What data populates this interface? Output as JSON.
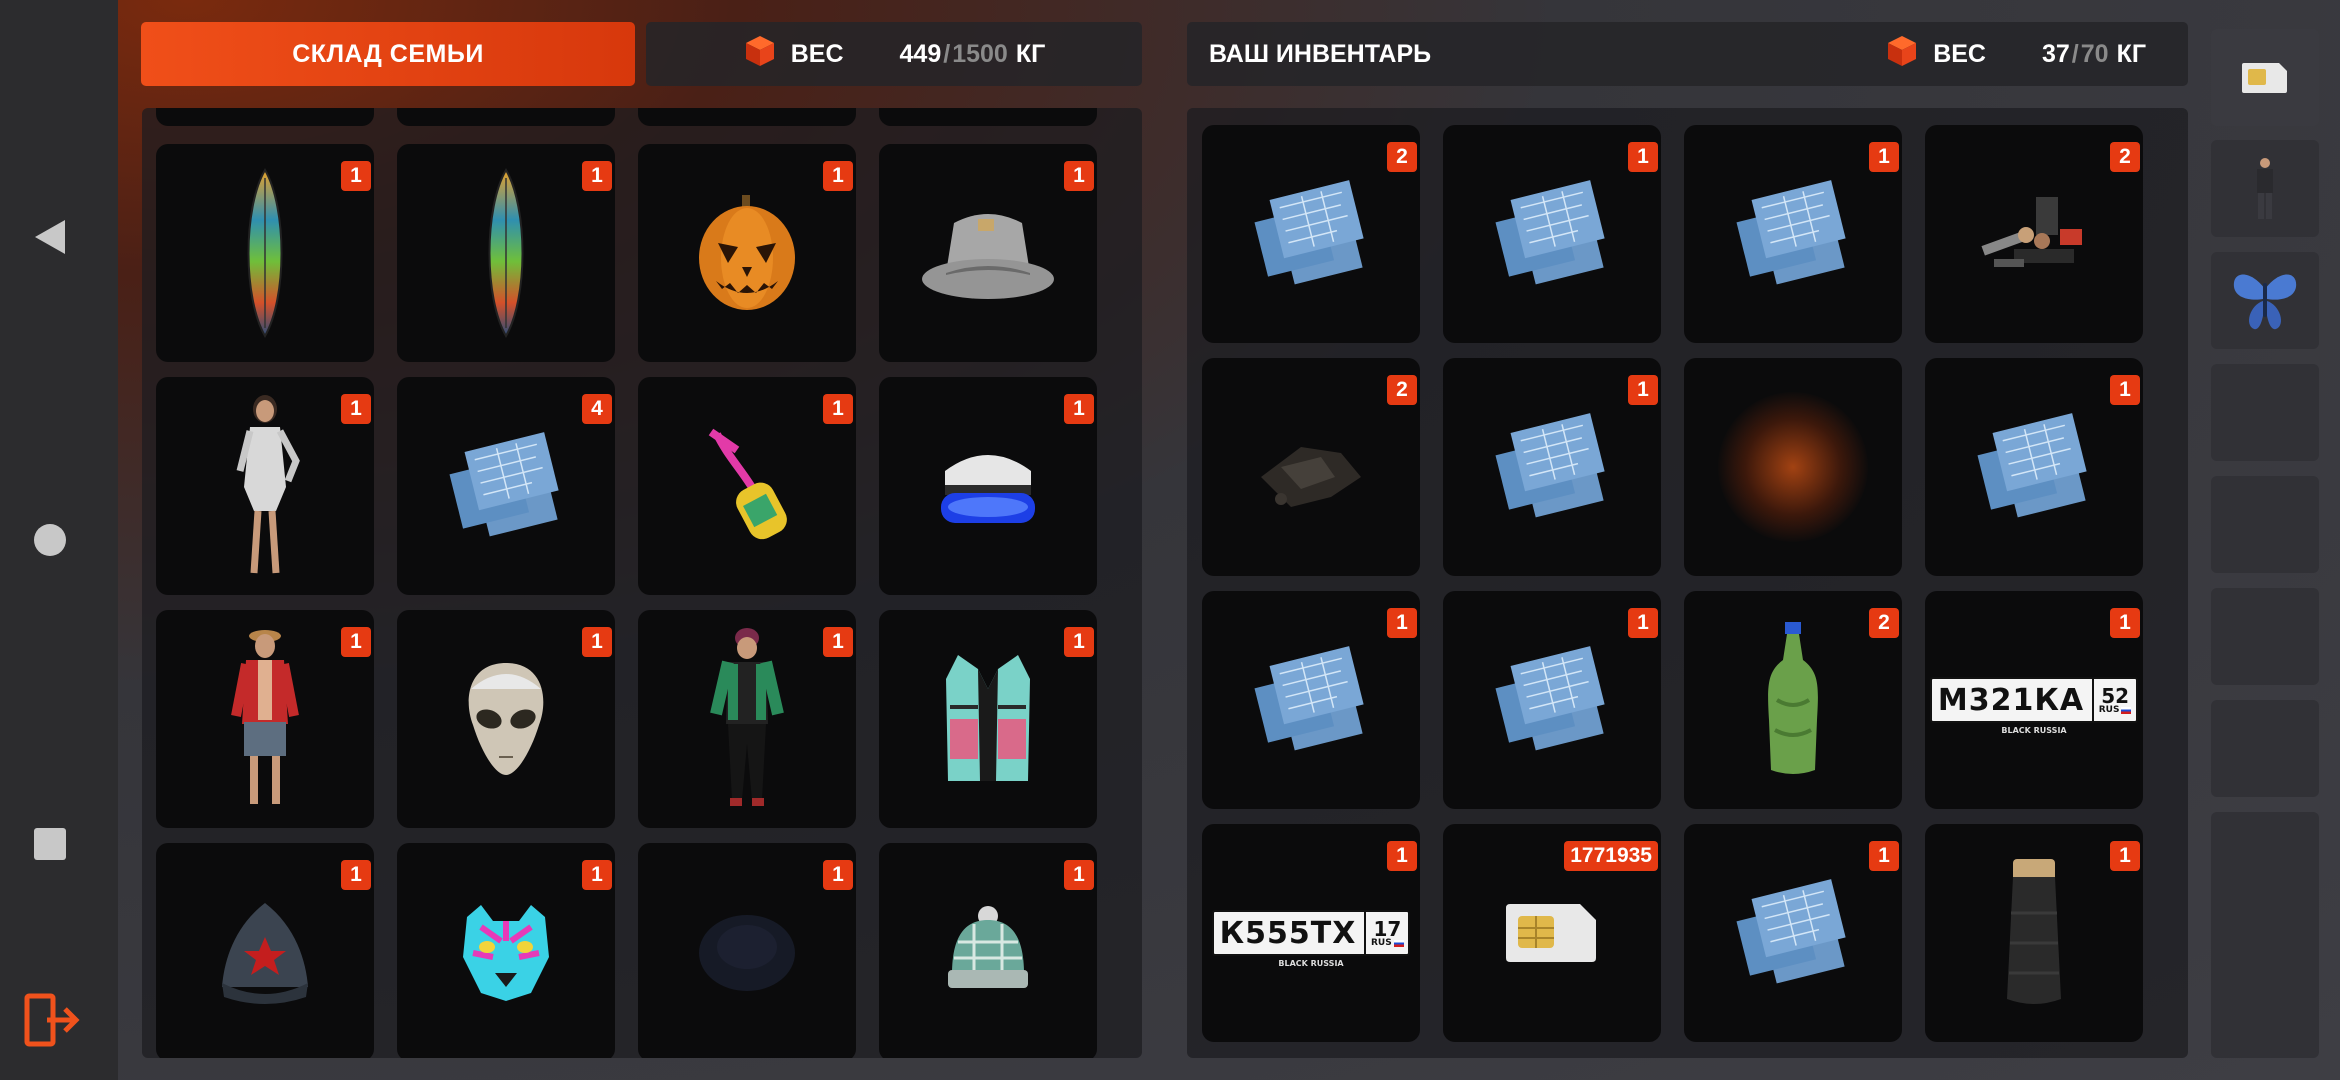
{
  "nav": {
    "icons": [
      "back-triangle-icon",
      "home-circle-icon",
      "recents-square-icon",
      "exit-door-icon"
    ]
  },
  "family_storage": {
    "title": "СКЛАД СЕМЬИ",
    "weight_label": "ВЕС",
    "weight_current": "449",
    "weight_sep": "/",
    "weight_max": "1500",
    "weight_unit": "КГ",
    "items": [
      {
        "name": "surfboard",
        "count": "1"
      },
      {
        "name": "surfboard",
        "count": "1"
      },
      {
        "name": "pumpkin-mask",
        "count": "1"
      },
      {
        "name": "bucket-hat",
        "count": "1"
      },
      {
        "name": "female-skin",
        "count": "1"
      },
      {
        "name": "blueprints",
        "count": "4"
      },
      {
        "name": "sling-bag",
        "count": "1"
      },
      {
        "name": "vr-headset",
        "count": "1"
      },
      {
        "name": "male-skin-red-jacket",
        "count": "1"
      },
      {
        "name": "alien-mask",
        "count": "1"
      },
      {
        "name": "male-skin-checkered",
        "count": "1"
      },
      {
        "name": "vest",
        "count": "1"
      },
      {
        "name": "budenovka-hat",
        "count": "1"
      },
      {
        "name": "tiger-mask",
        "count": "1"
      },
      {
        "name": "dark-hat",
        "count": "1"
      },
      {
        "name": "beanie",
        "count": "1"
      }
    ]
  },
  "inventory": {
    "title": "ВАШ ИНВЕНТАРЬ",
    "weight_label": "ВЕС",
    "weight_current": "37",
    "weight_sep": "/",
    "weight_max": "70",
    "weight_unit": "КГ",
    "items": [
      {
        "name": "blueprints",
        "count": "2"
      },
      {
        "name": "blueprints",
        "count": "1"
      },
      {
        "name": "blueprints",
        "count": "1"
      },
      {
        "name": "toolkit",
        "count": "2"
      },
      {
        "name": "scrap-parts",
        "count": "2"
      },
      {
        "name": "blueprints",
        "count": "1"
      },
      {
        "name": "empty-glow",
        "count": ""
      },
      {
        "name": "blueprints",
        "count": "1"
      },
      {
        "name": "blueprints",
        "count": "1"
      },
      {
        "name": "blueprints",
        "count": "1"
      },
      {
        "name": "bottle",
        "count": "2"
      },
      {
        "name": "license-plate",
        "count": "1",
        "plate_text": "М321КА",
        "region": "52",
        "rus": "RUS",
        "brand": "BLACK RUSSIA"
      },
      {
        "name": "license-plate",
        "count": "1",
        "plate_text": "К555ТХ",
        "region": "17",
        "rus": "RUS",
        "brand": "BLACK RUSSIA"
      },
      {
        "name": "sim-card",
        "count": "1771935"
      },
      {
        "name": "blueprints",
        "count": "1"
      },
      {
        "name": "thread-spool",
        "count": "1"
      }
    ]
  },
  "side_tabs": [
    "sim-card-icon",
    "skin-figure-icon",
    "butterfly-icon",
    "",
    "",
    "",
    "",
    ""
  ]
}
